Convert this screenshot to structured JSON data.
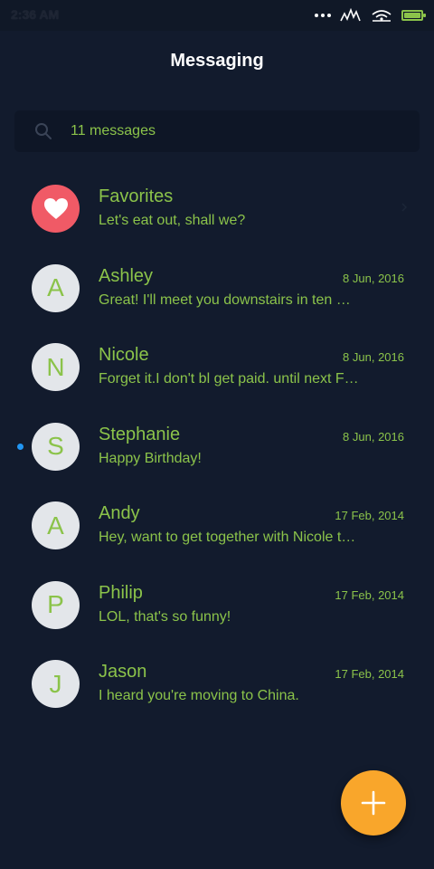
{
  "status_bar": {
    "time": "2:36 AM"
  },
  "header": {
    "title": "Messaging"
  },
  "search": {
    "text": "11 messages",
    "icon": "search-icon"
  },
  "conversations": [
    {
      "name": "Favorites",
      "avatar": "heart-icon",
      "preview": "Let's eat out, shall we?",
      "date": "",
      "unread": false
    },
    {
      "name": "Ashley",
      "avatar": "A",
      "preview": "Great! I'll meet you downstairs in ten minutes.",
      "date": "8 Jun, 2016",
      "unread": false
    },
    {
      "name": "Nicole",
      "avatar": "N",
      "preview": "Forget it.I don't bl get paid. until next Friday.",
      "date": "8 Jun, 2016",
      "unread": false
    },
    {
      "name": "Stephanie",
      "avatar": "S",
      "preview": "Happy Birthday!",
      "date": "8 Jun, 2016",
      "unread": true
    },
    {
      "name": "Andy",
      "avatar": "A",
      "preview": "Hey, want to get together with Nicole tonight?",
      "date": "17 Feb, 2014",
      "unread": false
    },
    {
      "name": "Philip",
      "avatar": "P",
      "preview": "LOL, that's so funny!",
      "date": "17 Feb, 2014",
      "unread": false
    },
    {
      "name": "Jason",
      "avatar": "J",
      "preview": "I heard you're moving to China.",
      "date": "17 Feb, 2014",
      "unread": false
    }
  ],
  "fab": {
    "icon": "plus-icon"
  },
  "colors": {
    "background": "#121b2d",
    "accent_text": "#8bc34a",
    "fab": "#f9a62b",
    "favorites_avatar": "#f05a66",
    "unread_dot": "#2196f3"
  }
}
